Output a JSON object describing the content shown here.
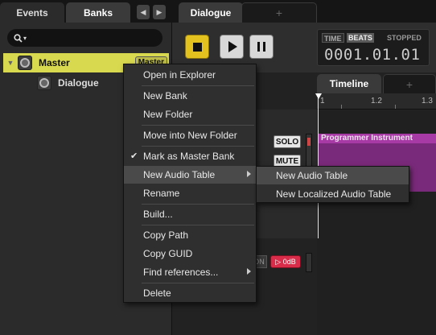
{
  "left_tabs": {
    "events": "Events",
    "banks": "Banks"
  },
  "nav": {
    "back": "◀",
    "forward": "▶"
  },
  "search": {
    "icon": "search-icon",
    "caret": "▾"
  },
  "tree": {
    "master": {
      "name": "Master",
      "badge": "Master"
    },
    "dialogue": {
      "name": "Dialogue"
    }
  },
  "right_tabs": {
    "dialogue": "Dialogue",
    "add": "+"
  },
  "transport": {
    "time_label": "TIME",
    "beats_label": "BEATS",
    "state": "STOPPED",
    "position": "0001.01.01"
  },
  "editor": {
    "timeline_tab": "Timeline",
    "add_tab": "+",
    "ruler_ticks": [
      "1",
      "1.2",
      "1.3"
    ],
    "instrument": "Programmer Instrument",
    "solo": "SOLO",
    "mute": "MUTE",
    "on_label": "ON",
    "volume": "▷ 0dB"
  },
  "context_menu": {
    "items": [
      {
        "label": "Open in Explorer"
      },
      {
        "label": "New Bank"
      },
      {
        "label": "New Folder"
      },
      {
        "label": "Move into New Folder"
      },
      {
        "label": "Mark as Master Bank",
        "checked": true
      },
      {
        "label": "New Audio Table",
        "submenu": true,
        "highlighted": true
      },
      {
        "label": "Rename"
      },
      {
        "label": "Build..."
      },
      {
        "label": "Copy Path"
      },
      {
        "label": "Copy GUID"
      },
      {
        "label": "Find references...",
        "submenu": true
      },
      {
        "label": "Delete"
      }
    ],
    "check_glyph": "✔"
  },
  "submenu": {
    "items": [
      {
        "label": "New Audio Table",
        "highlighted": true
      },
      {
        "label": "New Localized Audio Table"
      }
    ]
  },
  "colors": {
    "master_row": "#d9d950",
    "stop_button": "#e3c21f",
    "instrument": "#a83aa6",
    "volume_chip": "#d92c4a"
  }
}
